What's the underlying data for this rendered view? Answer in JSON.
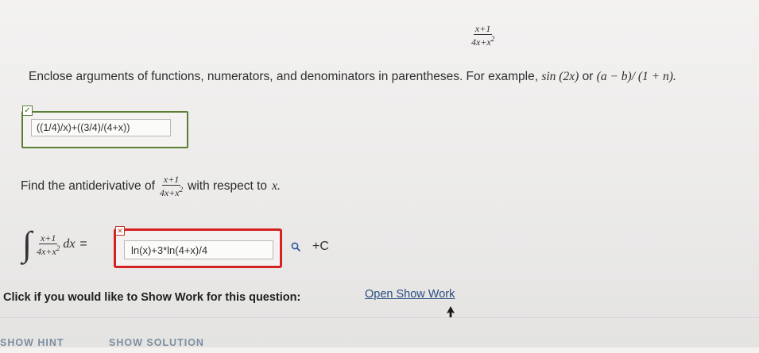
{
  "expression": {
    "numerator": "x+1",
    "denominator_base": "4x+x",
    "denominator_exp": "2"
  },
  "instructions": {
    "text": "Enclose arguments of functions, numerators, and denominators in parentheses. For example,",
    "example1": "sin (2x)",
    "or": "or",
    "example2": "(a − b)/ (1 + n)."
  },
  "answer1": {
    "value": "((1/4)/x)+((3/4)/(4+x))",
    "status": "correct"
  },
  "question": {
    "prefix": "Find the antiderivative of",
    "suffix": "with respect to",
    "variable": "x."
  },
  "integral": {
    "differential": "dx",
    "equals": "="
  },
  "answer2": {
    "value": "ln(x)+3*ln(4+x)/4",
    "status": "incorrect"
  },
  "constant": "+C",
  "show_work": {
    "label": "Click if you would like to Show Work for this question:",
    "link": "Open Show Work"
  },
  "buttons": {
    "hint": "SHOW HINT",
    "solution": "SHOW SOLUTION"
  },
  "colors": {
    "correct_border": "#5d7f35",
    "incorrect_border": "#d42222",
    "link": "#2a4d80"
  }
}
